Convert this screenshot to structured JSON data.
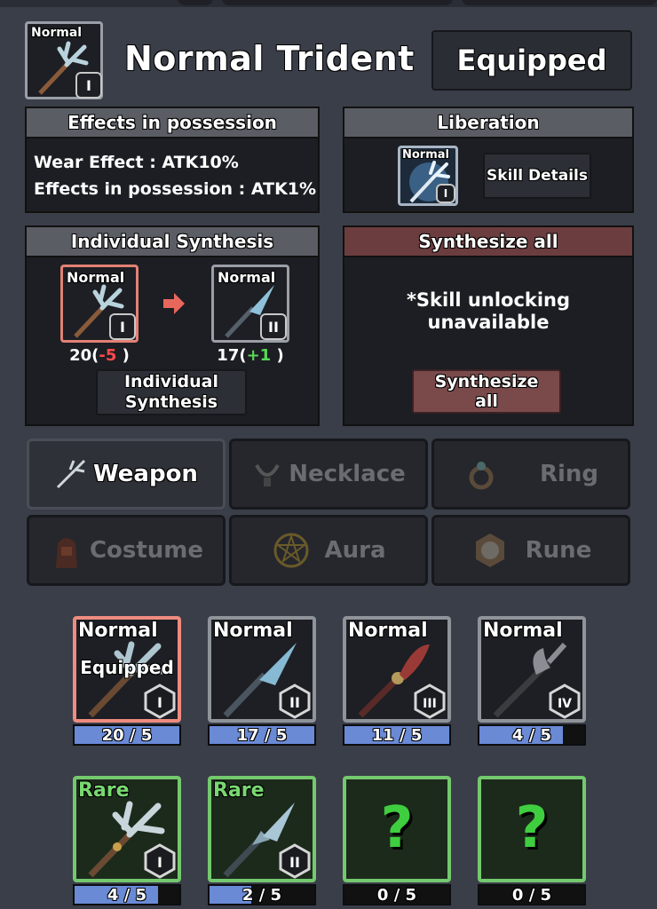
{
  "header": {
    "item_grade": "Normal",
    "item_tier": "I",
    "title": "Normal Trident",
    "equipped_label": "Equipped"
  },
  "possession": {
    "title": "Effects in possession",
    "wear_effect": "Wear Effect : ATK10%",
    "possession_effect": "Effects in possession : ATK1%"
  },
  "liberation": {
    "title": "Liberation",
    "item_grade": "Normal",
    "item_tier": "I",
    "skill_button": "Skill Details"
  },
  "individual_synthesis": {
    "title": "Individual Synthesis",
    "from": {
      "grade": "Normal",
      "tier": "I",
      "count": "20(",
      "delta": "-5",
      "close": " )"
    },
    "to": {
      "grade": "Normal",
      "tier": "II",
      "count": "17(",
      "delta": "+1",
      "close": " )"
    },
    "button_line1": "Individual",
    "button_line2": "Synthesis"
  },
  "synthesize_all": {
    "title": "Synthesize all",
    "notice_line1": "*Skill unlocking",
    "notice_line2": "unavailable",
    "button_line1": "Synthesize",
    "button_line2": "all"
  },
  "tabs": [
    {
      "label": "Weapon",
      "icon": "trident-icon",
      "active": true
    },
    {
      "label": "Necklace",
      "icon": "necklace-icon",
      "active": false
    },
    {
      "label": "Ring",
      "icon": "ring-icon",
      "active": false
    },
    {
      "label": "Costume",
      "icon": "costume-icon",
      "active": false
    },
    {
      "label": "Aura",
      "icon": "pentagram-icon",
      "active": false
    },
    {
      "label": "Rune",
      "icon": "rune-icon",
      "active": false
    }
  ],
  "grid": [
    {
      "grade": "Normal",
      "tier": "I",
      "count": "20 / 5",
      "progress": 1.0,
      "equipped": "Equipped",
      "weapon": "trident"
    },
    {
      "grade": "Normal",
      "tier": "II",
      "count": "17 / 5",
      "progress": 1.0,
      "equipped": "",
      "weapon": "spear"
    },
    {
      "grade": "Normal",
      "tier": "III",
      "count": "11 / 5",
      "progress": 1.0,
      "equipped": "",
      "weapon": "glaive"
    },
    {
      "grade": "Normal",
      "tier": "IV",
      "count": "4 / 5",
      "progress": 0.8,
      "equipped": "",
      "weapon": "halberd"
    },
    {
      "grade": "Rare",
      "tier": "I",
      "count": "4 / 5",
      "progress": 0.8,
      "equipped": "",
      "weapon": "trident-rare"
    },
    {
      "grade": "Rare",
      "tier": "II",
      "count": "2 / 5",
      "progress": 0.4,
      "equipped": "",
      "weapon": "spear-rare"
    },
    {
      "grade": "",
      "tier": "",
      "count": "0 / 5",
      "progress": 0,
      "equipped": "",
      "weapon": "unknown",
      "mystery": "?"
    },
    {
      "grade": "",
      "tier": "",
      "count": "0 / 5",
      "progress": 0,
      "equipped": "",
      "weapon": "unknown",
      "mystery": "?"
    }
  ],
  "colors": {
    "background": "#3a3e48",
    "panel": "#1c1e23",
    "negative": "#ff4a4a",
    "positive": "#57d957",
    "count_fill": "#6a8ad6",
    "normal_border": "#9a9ea6",
    "rare_border": "#74c86e",
    "selected_border": "#ef8b80",
    "synth_all_header": "#6b3d3f"
  }
}
